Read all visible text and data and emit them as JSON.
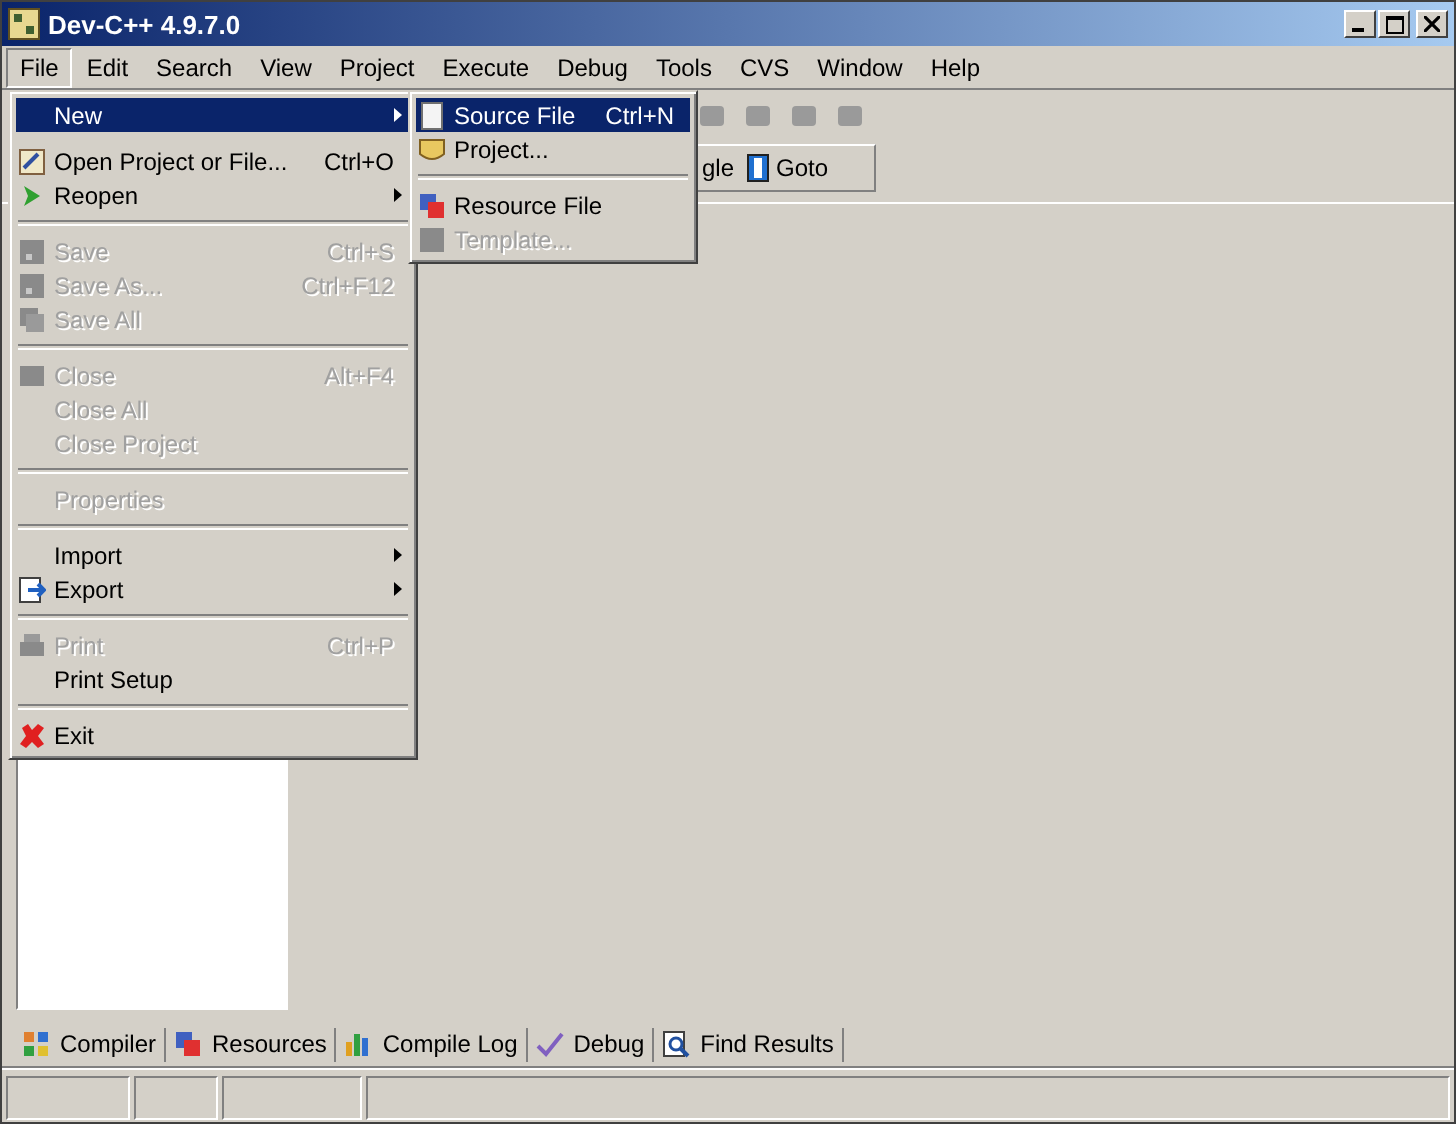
{
  "window": {
    "title": "Dev-C++ 4.9.7.0"
  },
  "menubar": [
    {
      "label": "File",
      "selected": true
    },
    {
      "label": "Edit",
      "selected": false
    },
    {
      "label": "Search",
      "selected": false
    },
    {
      "label": "View",
      "selected": false
    },
    {
      "label": "Project",
      "selected": false
    },
    {
      "label": "Execute",
      "selected": false
    },
    {
      "label": "Debug",
      "selected": false
    },
    {
      "label": "Tools",
      "selected": false
    },
    {
      "label": "CVS",
      "selected": false
    },
    {
      "label": "Window",
      "selected": false
    },
    {
      "label": "Help",
      "selected": false
    }
  ],
  "toolbar": {
    "partial_label": "gle",
    "goto_button": "Goto"
  },
  "file_menu": [
    {
      "kind": "item",
      "label": "New",
      "submenu": true,
      "disabled": false,
      "selected": true
    },
    {
      "kind": "gap"
    },
    {
      "kind": "item",
      "label": "Open Project or File...",
      "shortcut": "Ctrl+O",
      "disabled": false,
      "selected": false
    },
    {
      "kind": "item",
      "label": "Reopen",
      "submenu": true,
      "disabled": false,
      "selected": false
    },
    {
      "kind": "separator"
    },
    {
      "kind": "item",
      "label": "Save",
      "shortcut": "Ctrl+S",
      "disabled": true,
      "selected": false
    },
    {
      "kind": "item",
      "label": "Save As...",
      "shortcut": "Ctrl+F12",
      "disabled": true,
      "selected": false
    },
    {
      "kind": "item",
      "label": "Save All",
      "disabled": true,
      "selected": false
    },
    {
      "kind": "separator"
    },
    {
      "kind": "item",
      "label": "Close",
      "shortcut": "Alt+F4",
      "disabled": true,
      "selected": false
    },
    {
      "kind": "item",
      "label": "Close All",
      "disabled": true,
      "selected": false
    },
    {
      "kind": "item",
      "label": "Close Project",
      "disabled": true,
      "selected": false
    },
    {
      "kind": "separator"
    },
    {
      "kind": "item",
      "label": "Properties",
      "disabled": true,
      "selected": false
    },
    {
      "kind": "separator"
    },
    {
      "kind": "item",
      "label": "Import",
      "submenu": true,
      "disabled": false,
      "selected": false
    },
    {
      "kind": "item",
      "label": "Export",
      "submenu": true,
      "disabled": false,
      "selected": false
    },
    {
      "kind": "separator"
    },
    {
      "kind": "item",
      "label": "Print",
      "shortcut": "Ctrl+P",
      "disabled": true,
      "selected": false
    },
    {
      "kind": "item",
      "label": "Print Setup",
      "disabled": false,
      "selected": false
    },
    {
      "kind": "separator"
    },
    {
      "kind": "item",
      "label": "Exit",
      "disabled": false,
      "selected": false
    }
  ],
  "new_submenu": [
    {
      "kind": "item",
      "label": "Source File",
      "shortcut": "Ctrl+N",
      "disabled": false,
      "selected": true
    },
    {
      "kind": "item",
      "label": "Project...",
      "disabled": false,
      "selected": false
    },
    {
      "kind": "separator"
    },
    {
      "kind": "item",
      "label": "Resource File",
      "disabled": false,
      "selected": false
    },
    {
      "kind": "item",
      "label": "Template...",
      "disabled": true,
      "selected": false
    }
  ],
  "bottom_tabs": [
    "Compiler",
    "Resources",
    "Compile Log",
    "Debug",
    "Find Results"
  ]
}
